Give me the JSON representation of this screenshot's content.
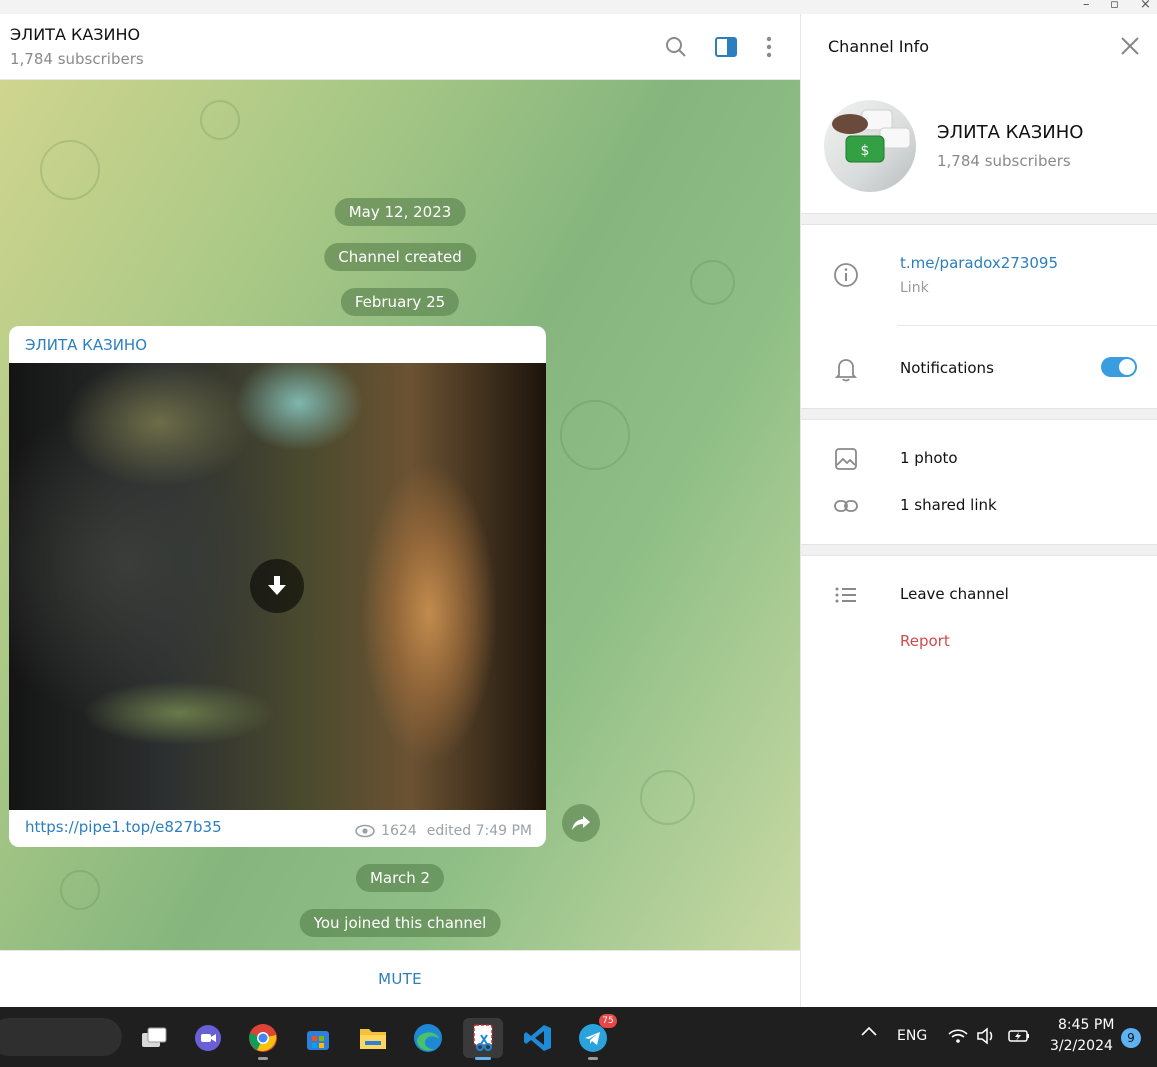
{
  "chat": {
    "title": "ЭЛИТА КАЗИНО",
    "subscribers": "1,784 subscribers",
    "date1": "May 12, 2023",
    "service1": "Channel created",
    "date2": "February 25",
    "post": {
      "author": "ЭЛИТА КАЗИНО",
      "link": "https://pipe1.top/e827b35",
      "views": "1624",
      "edited": "edited 7:49 PM"
    },
    "date3": "March 2",
    "service2": "You joined this channel",
    "mute_label": "MUTE"
  },
  "info": {
    "title": "Channel Info",
    "name": "ЭЛИТА КАЗИНО",
    "subscribers": "1,784 subscribers",
    "link": "t.me/paradox273095",
    "link_caption": "Link",
    "notifications": "Notifications",
    "notifications_on": true,
    "photos": "1 photo",
    "shared_links": "1 shared link",
    "leave": "Leave channel",
    "report": "Report"
  },
  "taskbar": {
    "language": "ENG",
    "time": "8:45 PM",
    "date": "3/2/2024",
    "notifications_count": "9",
    "telegram_badge": "75"
  },
  "colors": {
    "accent": "#2b7fbf",
    "danger": "#d24a4a",
    "toggle": "#3a9de0"
  }
}
